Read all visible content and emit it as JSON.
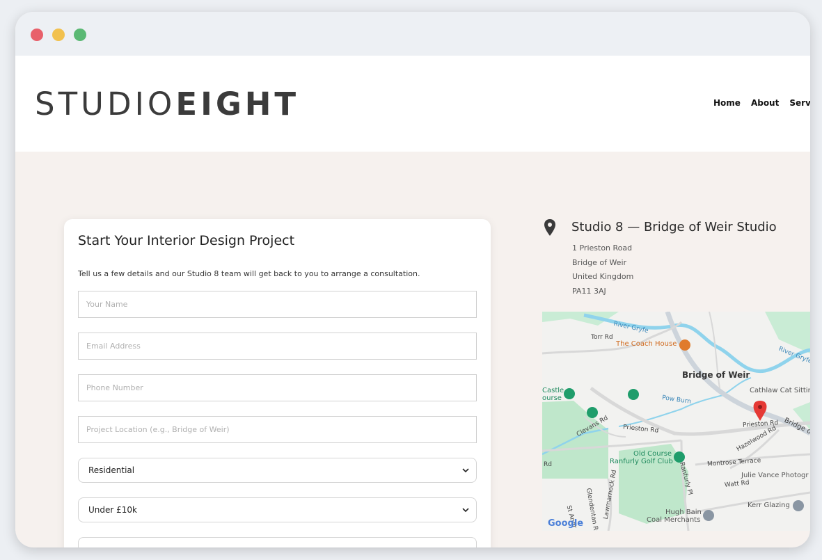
{
  "brand": {
    "light": "STUDIO",
    "bold": "EIGHT"
  },
  "nav": [
    {
      "label": "Home"
    },
    {
      "label": "About"
    },
    {
      "label": "Services"
    }
  ],
  "form": {
    "title": "Start Your Interior Design Project",
    "description": "Tell us a few details and our Studio 8 team will get back to you to arrange a consultation.",
    "fields": {
      "name": {
        "placeholder": "Your Name",
        "value": ""
      },
      "email": {
        "placeholder": "Email Address",
        "value": ""
      },
      "phone": {
        "placeholder": "Phone Number",
        "value": ""
      },
      "location": {
        "placeholder": "Project Location (e.g., Bridge of Weir)",
        "value": ""
      }
    },
    "project_type": {
      "selected": "Residential"
    },
    "budget": {
      "selected": "Under £10k"
    }
  },
  "studio": {
    "title": "Studio 8 — Bridge of Weir Studio",
    "address": [
      "1 Prieston Road",
      "Bridge of Weir",
      "United Kingdom",
      "PA11 3AJ"
    ]
  },
  "map": {
    "labels": {
      "river_gryfe_1": "River Gryfe",
      "river_gryfe_2": "River Gryfe",
      "torr_rd": "Torr Rd",
      "coach_house": "The Coach House",
      "town": "Bridge of Weir",
      "cathlaw": "Cathlaw Cat Sittin",
      "castle_course_1": "Castle",
      "castle_course_2": "ourse",
      "pow_burn": "Pow Burn",
      "clevans_rd": "Clevans Rd",
      "prieston_rd_1": "Prieston Rd",
      "prieston_rd_2": "Prieston Rd",
      "bridge_of": "Bridge of",
      "hazelwood_rd": "Hazelwood Rd",
      "old_course_1": "Old Course",
      "old_course_2": "Ranfurly Golf Club",
      "montrose": "Montrose Terrace",
      "julie_vance": "Julie Vance Photogr",
      "watt_rd": "Watt Rd",
      "lawmarnock_rd": "Lawmarnock Rd",
      "glendentan_rd": "Glendentan Rd",
      "ranfurly_pl": "Ranfurly Pl",
      "kerr_glazing": "Kerr Glazing",
      "hugh_bain_1": "Hugh Bain",
      "hugh_bain_2": "Coal Merchants",
      "st_andrews": "St Andr",
      "rd_left": "Rd",
      "google": "Google"
    }
  },
  "colors": {
    "accent_red": "#e8606a",
    "accent_yellow": "#f2c14e",
    "accent_green": "#5bb974",
    "page_bg": "#f6f1ee",
    "water": "#8fd3ec",
    "park": "#bfe7cb",
    "poi_orange": "#e07b2c",
    "poi_green": "#1f9d6b"
  }
}
